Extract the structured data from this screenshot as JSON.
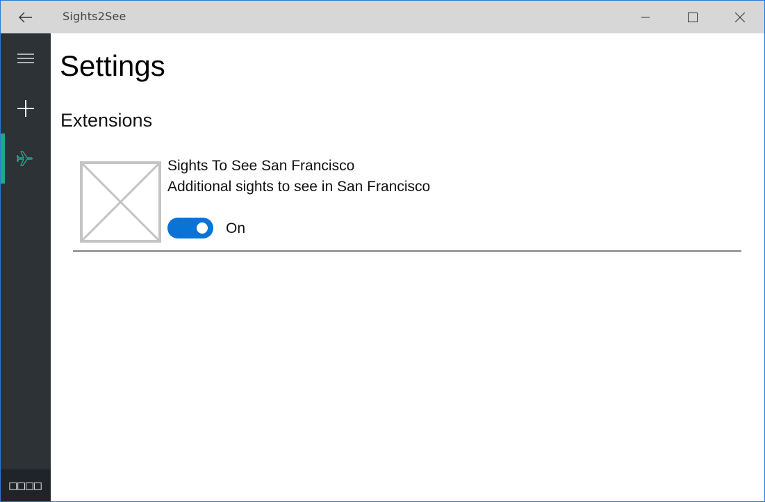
{
  "window": {
    "title": "Sights2See"
  },
  "titlebar": {
    "back_icon": "back-arrow-icon",
    "minimize_icon": "minimize-icon",
    "maximize_icon": "maximize-icon",
    "close_icon": "close-icon"
  },
  "sidebar": {
    "items": [
      {
        "icon": "hamburger-icon",
        "selected": false
      },
      {
        "icon": "add-icon",
        "selected": false
      },
      {
        "icon": "airplane-icon",
        "selected": true
      }
    ],
    "footer_text": "□□□□",
    "accent_color": "#1ea88d",
    "background_color": "#2d3237"
  },
  "main": {
    "page_title": "Settings",
    "section_title": "Extensions",
    "extensions": [
      {
        "name": "Sights To See San Francisco",
        "description": "Additional sights to see in San Francisco",
        "image": "placeholder-image-icon",
        "enabled": true,
        "toggle_label": "On"
      }
    ]
  },
  "colors": {
    "toggle_on": "#0a74d6",
    "titlebar": "#d7d7d7",
    "window_border": "#2b79d1"
  }
}
